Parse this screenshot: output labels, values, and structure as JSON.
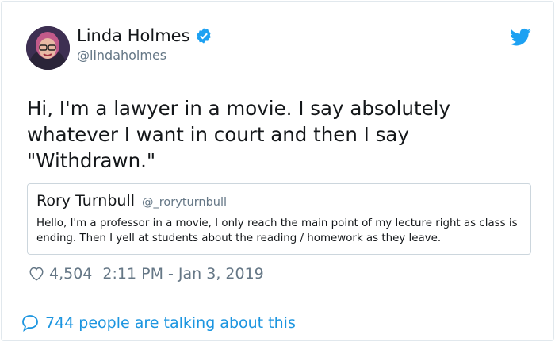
{
  "author": {
    "name": "Linda Holmes",
    "handle": "@lindaholmes",
    "verified": true
  },
  "tweet": {
    "text": "Hi, I'm a lawyer in a movie. I say absolutely whatever I want in court and then I say \"Withdrawn.\""
  },
  "quoted_tweet": {
    "name": "Rory Turnbull",
    "handle": "@_roryturnbull",
    "text": "Hello, I'm a professor in a movie, I only reach the main point of my lecture right as class is ending. Then I yell at students about the reading / homework as they leave."
  },
  "meta": {
    "likes": "4,504",
    "timestamp": "2:11 PM - Jan 3, 2019"
  },
  "footer": {
    "conversation": "744 people are talking about this"
  },
  "icons": {
    "verified": "verified-badge-icon",
    "brand": "twitter-bird-icon",
    "like": "heart-icon",
    "reply": "speech-bubble-icon"
  },
  "colors": {
    "brand_blue": "#1da1f2",
    "link_blue": "#1b95e0",
    "secondary_text": "#657786",
    "border": "#e1e8ed"
  }
}
